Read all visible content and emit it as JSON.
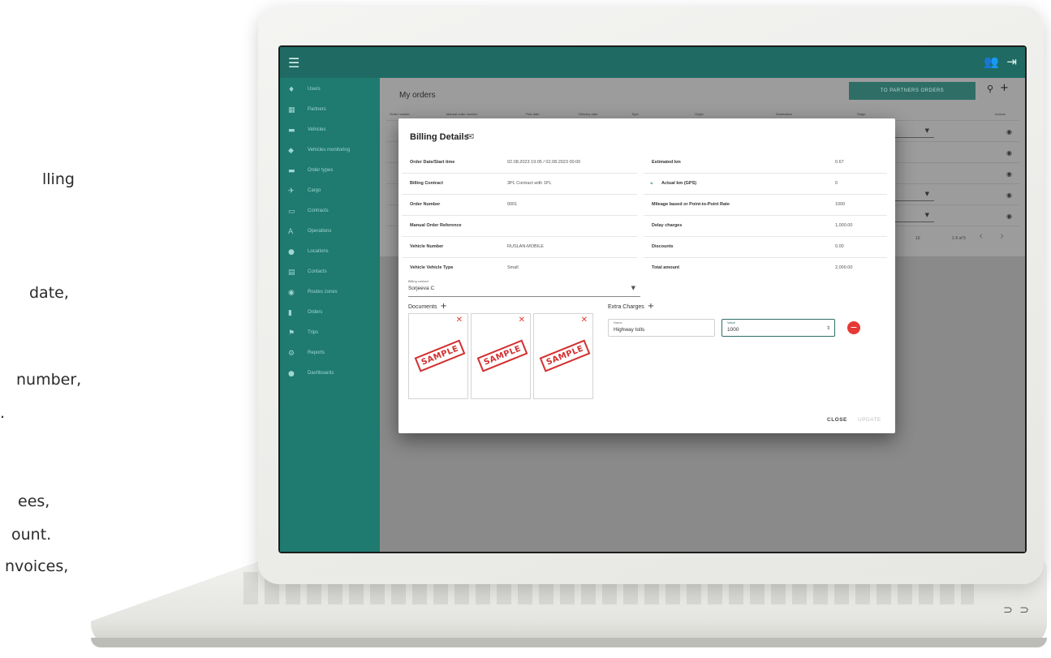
{
  "side_text": [
    "lling",
    "date,",
    "number,",
    ".",
    "ees,",
    "ount.",
    "nvoices,"
  ],
  "topbar": {
    "menu_icon": "☰",
    "user_icon": "👥",
    "logout_icon": "⇥"
  },
  "sidebar": {
    "items": [
      {
        "icon": "♦",
        "label": "Users"
      },
      {
        "icon": "▦",
        "label": "Partners"
      },
      {
        "icon": "▬",
        "label": "Vehicles"
      },
      {
        "icon": "◆",
        "label": "Vehicles monitoring"
      },
      {
        "icon": "▬",
        "label": "Order types"
      },
      {
        "icon": "✈",
        "label": "Cargo"
      },
      {
        "icon": "▭",
        "label": "Contracts"
      },
      {
        "icon": "A",
        "label": "Operations"
      },
      {
        "icon": "●",
        "label": "Locations"
      },
      {
        "icon": "▤",
        "label": "Contacts"
      },
      {
        "icon": "◉",
        "label": "Routes zones"
      },
      {
        "icon": "▮",
        "label": "Orders"
      },
      {
        "icon": "⚑",
        "label": "Trips"
      },
      {
        "icon": "⚙",
        "label": "Reports"
      },
      {
        "icon": "●",
        "label": "Dashboards"
      }
    ]
  },
  "list": {
    "title": "My orders",
    "partners_button": "TO PARTNERS ORDERS",
    "search_icon": "⚲",
    "add_icon": "+",
    "columns": [
      "Order number",
      "Manual order number",
      "Pick date",
      "Delivery date",
      "Type",
      "Origin",
      "Destination",
      "Stage",
      "Actions"
    ],
    "rows_visible": 5,
    "pager": {
      "per_page": "10",
      "range": "1-5 of 5"
    }
  },
  "dialog": {
    "title": "Billing Details",
    "left_fields": [
      {
        "label": "Order Date/Start time",
        "value": "02.08.2023 19:05 / 02.08.2023 00:00"
      },
      {
        "label": "Billing Contract",
        "value": "3PL Contract with 1PL"
      },
      {
        "label": "Order Number",
        "value": "0001"
      },
      {
        "label": "Manual Order Reference",
        "value": ""
      },
      {
        "label": "Vehicle Number",
        "value": "RUSLAN-MOBILE"
      },
      {
        "label": "Vehicle Vehicle Type",
        "value": "Small"
      }
    ],
    "right_fields": [
      {
        "label": "Estimated km",
        "value": "0.67"
      },
      {
        "label": "Actual km (GPS)",
        "value": "0"
      },
      {
        "label": "Mileage based or Point-to-Point Rate",
        "value": "1000"
      },
      {
        "label": "Delay charges",
        "value": "1,000.00"
      },
      {
        "label": "Discounts",
        "value": "0.00"
      },
      {
        "label": "Total amount",
        "value": "2,000.00"
      }
    ],
    "billing_contact": {
      "label": "Billing contact",
      "value": "Sorjeeva C"
    },
    "documents_label": "Documents",
    "documents": [
      {
        "stamp": "SAMPLE"
      },
      {
        "stamp": "SAMPLE"
      },
      {
        "stamp": "SAMPLE"
      }
    ],
    "extra_charges_label": "Extra Charges",
    "extra_charge": {
      "name_label": "Name",
      "name_value": "Highway tolls",
      "value_label": "Value",
      "value_value": "1000"
    },
    "close_label": "CLOSE",
    "update_label": "UPDATE"
  },
  "colors": {
    "topbar": "#1f6b63",
    "sidebar": "#1f7a70",
    "danger": "#e53935"
  }
}
